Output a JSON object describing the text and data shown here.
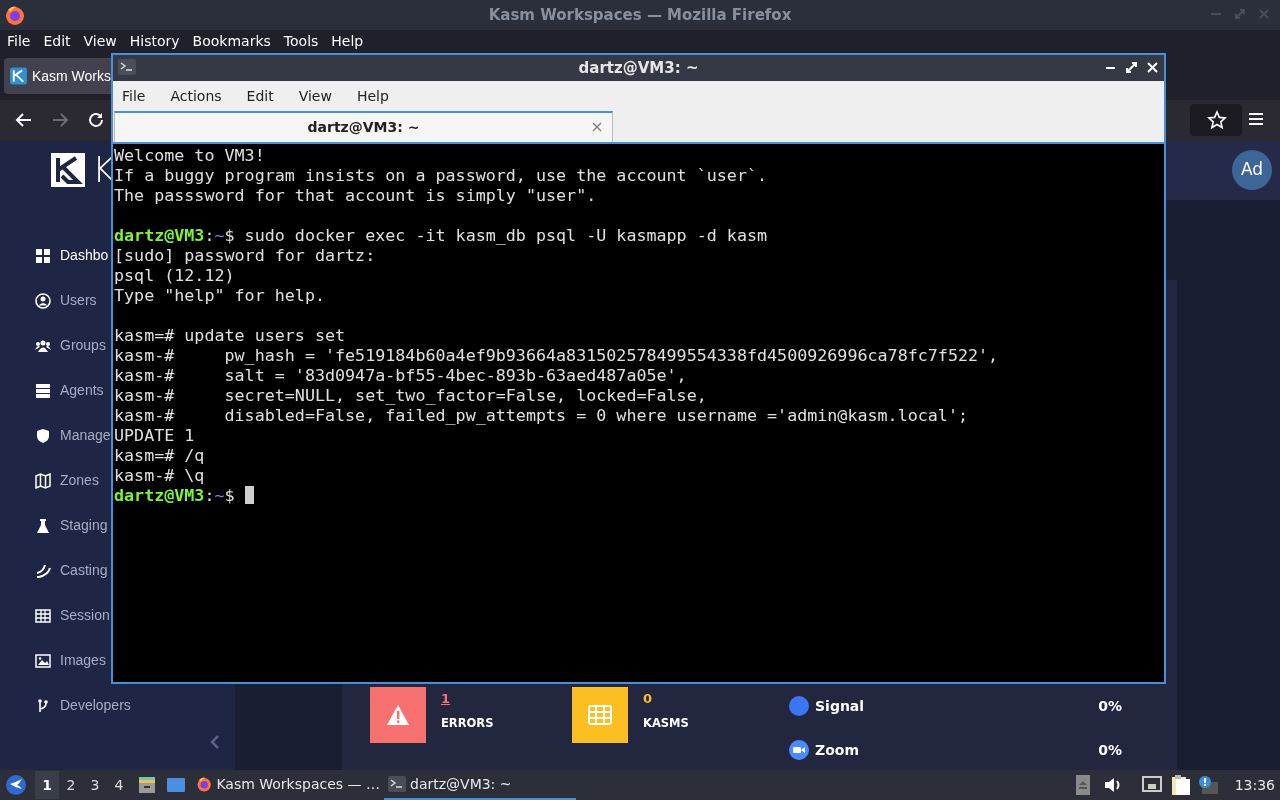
{
  "firefox": {
    "title": "Kasm Workspaces — Mozilla Firefox",
    "menu": [
      "File",
      "Edit",
      "View",
      "History",
      "Bookmarks",
      "Tools",
      "Help"
    ],
    "tabs": [
      {
        "label": "Kasm Works",
        "selected": true
      }
    ]
  },
  "kasm": {
    "logo_text": "K",
    "avatar": "Ad",
    "sidebar": [
      {
        "kind": "dashboard",
        "label": "Dashbo",
        "selected": true
      },
      {
        "kind": "users",
        "label": "Users",
        "selected": false
      },
      {
        "kind": "groups",
        "label": "Groups",
        "selected": false
      },
      {
        "kind": "agents",
        "label": "Agents",
        "selected": false
      },
      {
        "kind": "manage",
        "label": "Manage",
        "selected": false
      },
      {
        "kind": "zones",
        "label": "Zones",
        "selected": false
      },
      {
        "kind": "staging",
        "label": "Staging",
        "selected": false
      },
      {
        "kind": "casting",
        "label": "Casting",
        "selected": false
      },
      {
        "kind": "sessions",
        "label": "Session",
        "selected": false
      },
      {
        "kind": "images",
        "label": "Images",
        "selected": false
      },
      {
        "kind": "developers",
        "label": "Developers",
        "selected": false
      }
    ],
    "stats": [
      {
        "kind": "errors",
        "value": "1",
        "label": "ERRORS",
        "color": "#f87171"
      },
      {
        "kind": "kasms",
        "value": "0",
        "label": "KASMS",
        "color": "#fbbf24"
      }
    ],
    "usage": [
      {
        "kind": "signal",
        "name": "Signal",
        "reading": "0%"
      },
      {
        "kind": "zoom",
        "name": "Zoom",
        "reading": "0%"
      }
    ]
  },
  "terminal": {
    "title": "dartz@VM3: ~",
    "menu": [
      "File",
      "Actions",
      "Edit",
      "View",
      "Help"
    ],
    "tabs": [
      {
        "label": "dartz@VM3: ~",
        "selected": true
      }
    ],
    "lines": [
      {
        "kind": "output",
        "text": "Welcome to VM3!"
      },
      {
        "kind": "output",
        "text": "If a buggy program insists on a password, use the account `user`."
      },
      {
        "kind": "output",
        "text": "The passsword for that account is simply \"user\"."
      },
      {
        "kind": "blank"
      },
      {
        "kind": "prompt",
        "user": "dartz@VM3",
        "sep": ":",
        "path": "~",
        "symbol": "$",
        "command": " sudo docker exec -it kasm_db psql -U kasmapp -d kasm",
        "cursor": false
      },
      {
        "kind": "output",
        "text": "[sudo] password for dartz:"
      },
      {
        "kind": "output",
        "text": "psql (12.12)"
      },
      {
        "kind": "output",
        "text": "Type \"help\" for help."
      },
      {
        "kind": "blank"
      },
      {
        "kind": "output",
        "text": "kasm=# update users set"
      },
      {
        "kind": "output",
        "text": "kasm-#     pw_hash = 'fe519184b60a4ef9b93664a831502578499554338fd4500926996ca78fc7f522',"
      },
      {
        "kind": "output",
        "text": "kasm-#     salt = '83d0947a-bf55-4bec-893b-63aed487a05e',"
      },
      {
        "kind": "output",
        "text": "kasm-#     secret=NULL, set_two_factor=False, locked=False,"
      },
      {
        "kind": "output",
        "text": "kasm-#     disabled=False, failed_pw_attempts = 0 where username ='admin@kasm.local';"
      },
      {
        "kind": "output",
        "text": "UPDATE 1"
      },
      {
        "kind": "output",
        "text": "kasm=# /q"
      },
      {
        "kind": "output",
        "text": "kasm-# \\q"
      },
      {
        "kind": "prompt",
        "user": "dartz@VM3",
        "sep": ":",
        "path": "~",
        "symbol": "$",
        "cursor": true
      }
    ]
  },
  "taskbar": {
    "workspaces": [
      {
        "label": "1",
        "selected": true
      },
      {
        "label": "2",
        "selected": false
      },
      {
        "label": "3",
        "selected": false
      },
      {
        "label": "4",
        "selected": false
      }
    ],
    "tasks": [
      {
        "kind": "firefox",
        "label": "Kasm Workspaces — …",
        "selected": false
      },
      {
        "kind": "terminal",
        "label": "dartz@VM3: ~",
        "selected": true
      }
    ],
    "clock": "13:36"
  }
}
